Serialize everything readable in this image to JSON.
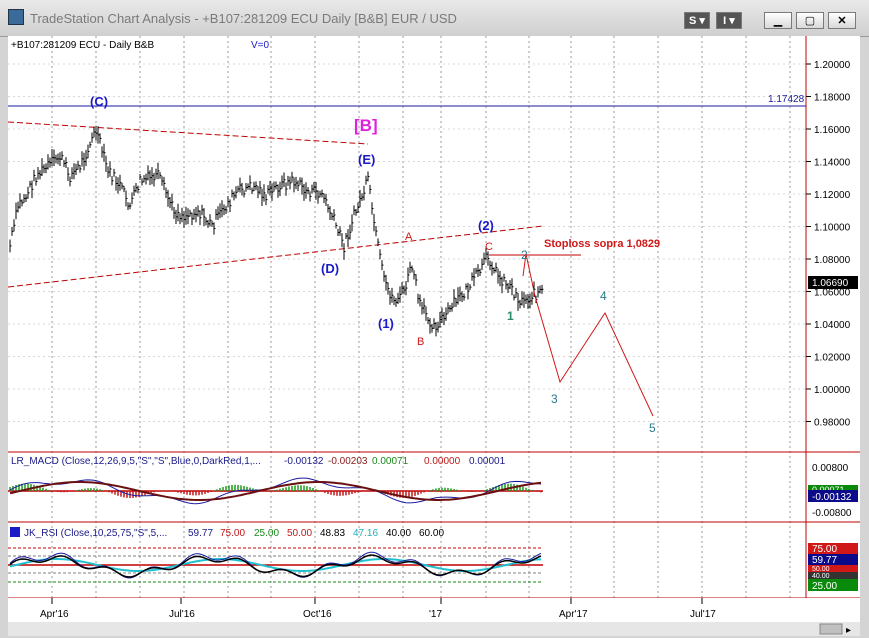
{
  "window": {
    "title": "TradeStation Chart Analysis - +B107:281209 ECU Daily [B&B] EUR / USD",
    "buttons": [
      {
        "label": "S",
        "name": "s-menu-button"
      },
      {
        "label": "I",
        "name": "i-menu-button"
      }
    ],
    "controls": [
      "minimize-icon",
      "restore-icon",
      "close-icon"
    ]
  },
  "chart_header": {
    "symbol": "+B107:281209 ECU - Daily  B&B",
    "volume": "V=0"
  },
  "price_axis": {
    "ticks": [
      "1.20000",
      "1.18000",
      "1.16000",
      "1.14000",
      "1.12000",
      "1.10000",
      "1.08000",
      "1.06000",
      "1.04000",
      "1.02000",
      "1.00000",
      "0.98000"
    ],
    "last_price": "1.06690",
    "line_label": "1.17428"
  },
  "annotations": {
    "C_major": "(C)",
    "B_major": "[B]",
    "E": "(E)",
    "D": "(D)",
    "one_paren": "(1)",
    "two_paren": "(2)",
    "A_red": "A",
    "B_red": "B",
    "C_red": "C",
    "stoploss": "Stoploss sopra 1,0829",
    "wave1": "1",
    "wave2": "2",
    "wave3": "3",
    "wave4": "4",
    "wave5": "5"
  },
  "macd": {
    "label": "LR_MACD (Close,12,26,9,5,\"S\",\"S\",Blue,0,DarkRed,1,...",
    "v1": "-0.00132",
    "v2": "-0.00203",
    "v3": "0.00071",
    "v4": "0.00000",
    "v5": "0.00001",
    "axis_top": "0.00800",
    "axis_bottom": "-0.00800",
    "badge_green": "0.00071",
    "badge_blue": "-0.00132"
  },
  "rsi": {
    "label": "JK_RSI (Close,10,25,75,\"S\",5,...",
    "v1": "59.77",
    "v2": "75.00",
    "v3": "25.00",
    "v4": "50.00",
    "v5": "48.83",
    "v6": "47.16",
    "v7": "40.00",
    "v8": "60.00",
    "badge_75": "75.00",
    "badge_5977": "59.77",
    "badge_5000": "50.00",
    "badge_40": "40.00",
    "badge_25": "25.00"
  },
  "time_axis": {
    "labels": [
      "Apr'16",
      "Jul'16",
      "Oct'16",
      "'17",
      "Apr'17",
      "Jul'17"
    ]
  },
  "colors": {
    "price_bars": "#000000",
    "trendline": "#c00000",
    "horizontal_line": "#1a1aa0",
    "wave_blue": "#1a1ac8",
    "wave_teal": "#2a7a8a",
    "wave_red": "#d01818",
    "magenta": "#e020e0",
    "projection": "#d01818"
  }
}
